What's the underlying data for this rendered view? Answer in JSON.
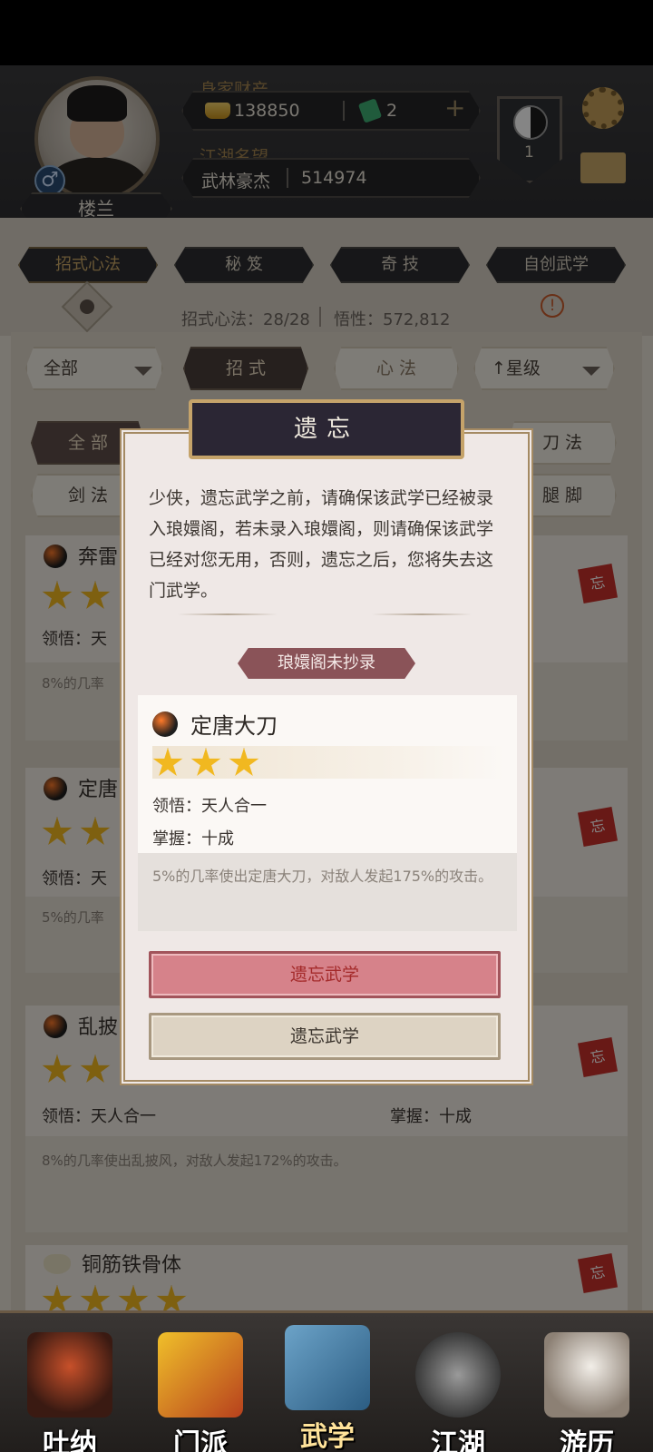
{
  "header": {
    "player_name": "楼兰",
    "gender_symbol": "♂",
    "wealth_label": "身家财产",
    "gold": "138850",
    "jade": "2",
    "plus": "+",
    "fame_label": "江湖名望",
    "fame_title": "武林豪杰",
    "fame_value": "514974",
    "rank_level": "1"
  },
  "tabs": [
    "招式心法",
    "秘 笈",
    "奇 技",
    "自创武学"
  ],
  "info": {
    "text": "招式心法：28/28",
    "insight": "悟性：572,812",
    "warn": "!"
  },
  "filters": {
    "all": "全部",
    "moves": "招 式",
    "mind": "心 法",
    "sort": "↑星级",
    "cat_all": "全 部",
    "cat_blade": "刀 法",
    "cat_sword": "剑 法",
    "cat_leg": "腿 脚"
  },
  "list": [
    {
      "name": "奔雷",
      "comprehension": "领悟：天",
      "desc": "8%的几率",
      "mark": "忘"
    },
    {
      "name": "定唐",
      "comprehension": "领悟：天",
      "desc": "5%的几率",
      "mark": "忘"
    },
    {
      "name": "乱披",
      "comprehension": "领悟：天人合一",
      "mastery": "掌握：十成",
      "desc": "8%的几率使出乱披风，对敌人发起172%的攻击。",
      "mark": "忘"
    },
    {
      "name": "铜筋铁骨体",
      "mark": "忘"
    }
  ],
  "dialog": {
    "title": "遗忘",
    "message": "少侠，遗忘武学之前，请确保该武学已经被录入琅嬛阁，若未录入琅嬛阁，则请确保该武学已经对您无用，否则，遗忘之后，您将失去这门武学。",
    "ribbon": "琅嬛阁未抄录",
    "skill_name": "定唐大刀",
    "stars": 3,
    "comprehension": "领悟：天人合一",
    "mastery": "掌握：十成",
    "skill_desc": "5%的几率使出定唐大刀，对敌人发起175%的攻击。",
    "btn_forget_red": "遗忘武学",
    "btn_forget_beige": "遗忘武学"
  },
  "nav": [
    "吐纳",
    "门派",
    "武学",
    "江湖",
    "游历"
  ]
}
